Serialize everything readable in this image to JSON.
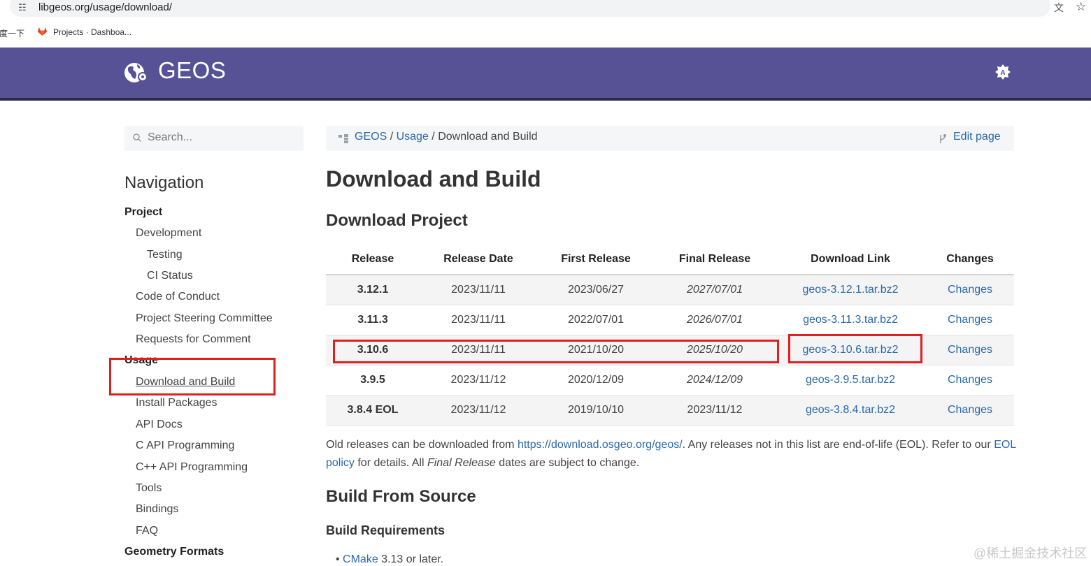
{
  "browser": {
    "url": "libgeos.org/usage/download/",
    "bookmarks": [
      "度一下",
      "Projects · Dashboa..."
    ]
  },
  "header": {
    "logo_text": "GEOS"
  },
  "sidebar": {
    "search_placeholder": "Search...",
    "nav_title": "Navigation",
    "items": [
      {
        "label": "Project",
        "kind": "section"
      },
      {
        "label": "Development",
        "kind": "item"
      },
      {
        "label": "Testing",
        "kind": "subitem"
      },
      {
        "label": "CI Status",
        "kind": "subitem"
      },
      {
        "label": "Code of Conduct",
        "kind": "item"
      },
      {
        "label": "Project Steering Committee",
        "kind": "item"
      },
      {
        "label": "Requests for Comment",
        "kind": "item"
      },
      {
        "label": "Usage",
        "kind": "section"
      },
      {
        "label": "Download and Build",
        "kind": "item",
        "current": true
      },
      {
        "label": "Install Packages",
        "kind": "item"
      },
      {
        "label": "API Docs",
        "kind": "item"
      },
      {
        "label": "C API Programming",
        "kind": "item"
      },
      {
        "label": "C++ API Programming",
        "kind": "item"
      },
      {
        "label": "Tools",
        "kind": "item"
      },
      {
        "label": "Bindings",
        "kind": "item"
      },
      {
        "label": "FAQ",
        "kind": "item"
      },
      {
        "label": "Geometry Formats",
        "kind": "section"
      }
    ]
  },
  "breadcrumb": {
    "root": "GEOS",
    "sep": "/",
    "section": "Usage",
    "current": "Download and Build",
    "edit_label": "Edit page"
  },
  "main": {
    "title": "Download and Build",
    "download_heading": "Download Project",
    "table": {
      "headers": [
        "Release",
        "Release Date",
        "First Release",
        "Final Release",
        "Download Link",
        "Changes"
      ],
      "rows": [
        [
          "3.12.1",
          "2023/11/11",
          "2023/06/27",
          "2027/07/01",
          "geos-3.12.1.tar.bz2",
          "Changes"
        ],
        [
          "3.11.3",
          "2023/11/11",
          "2022/07/01",
          "2026/07/01",
          "geos-3.11.3.tar.bz2",
          "Changes"
        ],
        [
          "3.10.6",
          "2023/11/11",
          "2021/10/20",
          "2025/10/20",
          "geos-3.10.6.tar.bz2",
          "Changes"
        ],
        [
          "3.9.5",
          "2023/11/12",
          "2020/12/09",
          "2024/12/09",
          "geos-3.9.5.tar.bz2",
          "Changes"
        ],
        [
          "3.8.4 EOL",
          "2023/11/12",
          "2019/10/10",
          "2023/11/12",
          "geos-3.8.4.tar.bz2",
          "Changes"
        ]
      ],
      "italic_final": [
        true,
        true,
        true,
        true,
        false
      ]
    },
    "old_releases": {
      "text1": "Old releases can be downloaded from ",
      "link1": "https://download.osgeo.org/geos/",
      "text2": ". Any releases not in this list are end-of-life (EOL). Refer to our ",
      "link2": "EOL policy",
      "text3": " for details. All ",
      "em": "Final Release",
      "text4": " dates are subject to change."
    },
    "build_heading": "Build From Source",
    "req_heading": "Build Requirements",
    "req_item_link": "CMake",
    "req_item_text": " 3.13 or later."
  },
  "watermark": "@稀土掘金技术社区",
  "colors": {
    "header_bg": "#575296",
    "header_border": "#2d2a47",
    "link": "#2c6aa8",
    "highlight_box": "#e02020"
  }
}
